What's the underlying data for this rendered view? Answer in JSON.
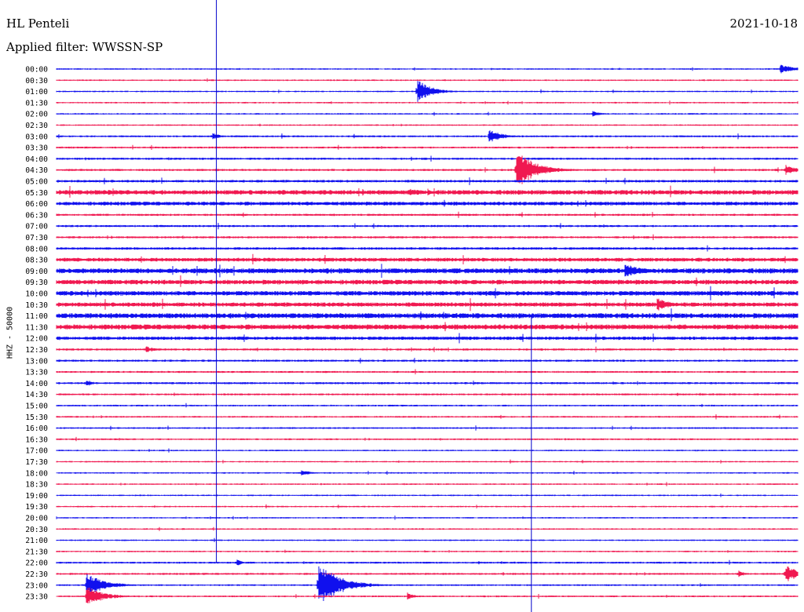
{
  "header": {
    "station": "HL Penteli",
    "filter": "Applied filter: WWSSN-SP",
    "date": "2021-10-18"
  },
  "chart_data": {
    "type": "line",
    "title": "HL Penteli",
    "subtitle": "Applied filter: WWSSN-SP",
    "date": "2021-10-18",
    "ylabel": "HHZ - 50000",
    "colors": {
      "odd_rows": "#1010ee",
      "even_rows": "#f01850",
      "markers": "#0000cc"
    },
    "rows": [
      "00:00",
      "00:30",
      "01:00",
      "01:30",
      "02:00",
      "02:30",
      "03:00",
      "03:30",
      "04:00",
      "04:30",
      "05:00",
      "05:30",
      "06:00",
      "06:30",
      "07:00",
      "07:30",
      "08:00",
      "08:30",
      "09:00",
      "09:30",
      "10:00",
      "10:30",
      "11:00",
      "11:30",
      "12:00",
      "12:30",
      "13:00",
      "13:30",
      "14:00",
      "14:30",
      "15:00",
      "15:30",
      "16:00",
      "16:30",
      "17:00",
      "17:30",
      "18:00",
      "18:30",
      "19:00",
      "19:30",
      "20:00",
      "20:30",
      "21:00",
      "21:30",
      "22:00",
      "22:30",
      "23:00",
      "23:30"
    ],
    "noise_level": [
      0.7,
      0.7,
      0.7,
      0.7,
      0.7,
      0.7,
      0.9,
      0.9,
      1.0,
      1.0,
      1.2,
      2.2,
      1.8,
      1.0,
      1.0,
      1.0,
      1.2,
      1.8,
      2.4,
      2.2,
      2.2,
      2.0,
      2.4,
      2.4,
      1.6,
      1.0,
      1.0,
      0.9,
      1.0,
      0.9,
      0.8,
      0.8,
      0.8,
      0.8,
      0.7,
      0.7,
      0.7,
      0.7,
      0.7,
      0.7,
      0.7,
      0.7,
      0.7,
      0.7,
      0.9,
      0.9,
      0.8,
      0.8
    ],
    "events": [
      {
        "row": 0,
        "min": 29.3,
        "amp": 6,
        "dur": 1.2
      },
      {
        "row": 2,
        "min": 14.6,
        "amp": 16,
        "dur": 1.0
      },
      {
        "row": 4,
        "min": 21.7,
        "amp": 4,
        "dur": 0.6
      },
      {
        "row": 6,
        "min": 6.3,
        "amp": 5,
        "dur": 0.6
      },
      {
        "row": 6,
        "min": 17.5,
        "amp": 10,
        "dur": 0.9
      },
      {
        "row": 9,
        "min": 18.6,
        "amp": 26,
        "dur": 1.4
      },
      {
        "row": 9,
        "min": 29.5,
        "amp": 7,
        "dur": 0.8
      },
      {
        "row": 11,
        "min": 14.3,
        "amp": 6,
        "dur": 0.9
      },
      {
        "row": 18,
        "min": 23.0,
        "amp": 10,
        "dur": 1.3
      },
      {
        "row": 21,
        "min": 24.3,
        "amp": 10,
        "dur": 0.9
      },
      {
        "row": 25,
        "min": 3.6,
        "amp": 5,
        "dur": 0.6
      },
      {
        "row": 28,
        "min": 1.2,
        "amp": 5,
        "dur": 0.5
      },
      {
        "row": 36,
        "min": 9.9,
        "amp": 5,
        "dur": 0.6
      },
      {
        "row": 44,
        "min": 7.3,
        "amp": 5,
        "dur": 0.4
      },
      {
        "row": 45,
        "min": 27.6,
        "amp": 5,
        "dur": 0.5
      },
      {
        "row": 45,
        "min": 29.5,
        "amp": 12,
        "dur": 1.0
      },
      {
        "row": 46,
        "min": 1.2,
        "amp": 16,
        "dur": 1.3
      },
      {
        "row": 46,
        "min": 10.6,
        "amp": 30,
        "dur": 1.5
      },
      {
        "row": 47,
        "min": 1.2,
        "amp": 14,
        "dur": 1.2
      },
      {
        "row": 47,
        "min": 14.2,
        "amp": 5,
        "dur": 0.5
      }
    ],
    "markers": [
      {
        "min": 6.47,
        "from_row": 0,
        "to_row": 44
      },
      {
        "min": 19.22,
        "from_row": 22,
        "to_row": 47
      }
    ]
  }
}
